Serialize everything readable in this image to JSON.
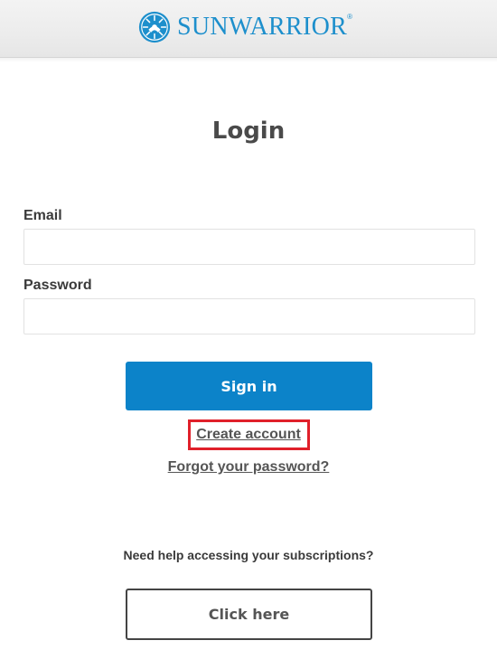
{
  "header": {
    "brand_name": "SUNWARRIOR",
    "brand_reg": "®",
    "logo_icon": "sun-warrior-logo-icon",
    "brand_color": "#1d8fcc"
  },
  "main": {
    "title": "Login",
    "email_label": "Email",
    "email_value": "",
    "password_label": "Password",
    "password_value": "",
    "signin_label": "Sign in",
    "signin_color": "#0c83c9",
    "create_account_label": "Create account",
    "create_account_highlight_color": "#e0202a",
    "forgot_password_label": "Forgot your password?",
    "help_text": "Need help accessing your subscriptions?",
    "click_here_label": "Click here"
  }
}
